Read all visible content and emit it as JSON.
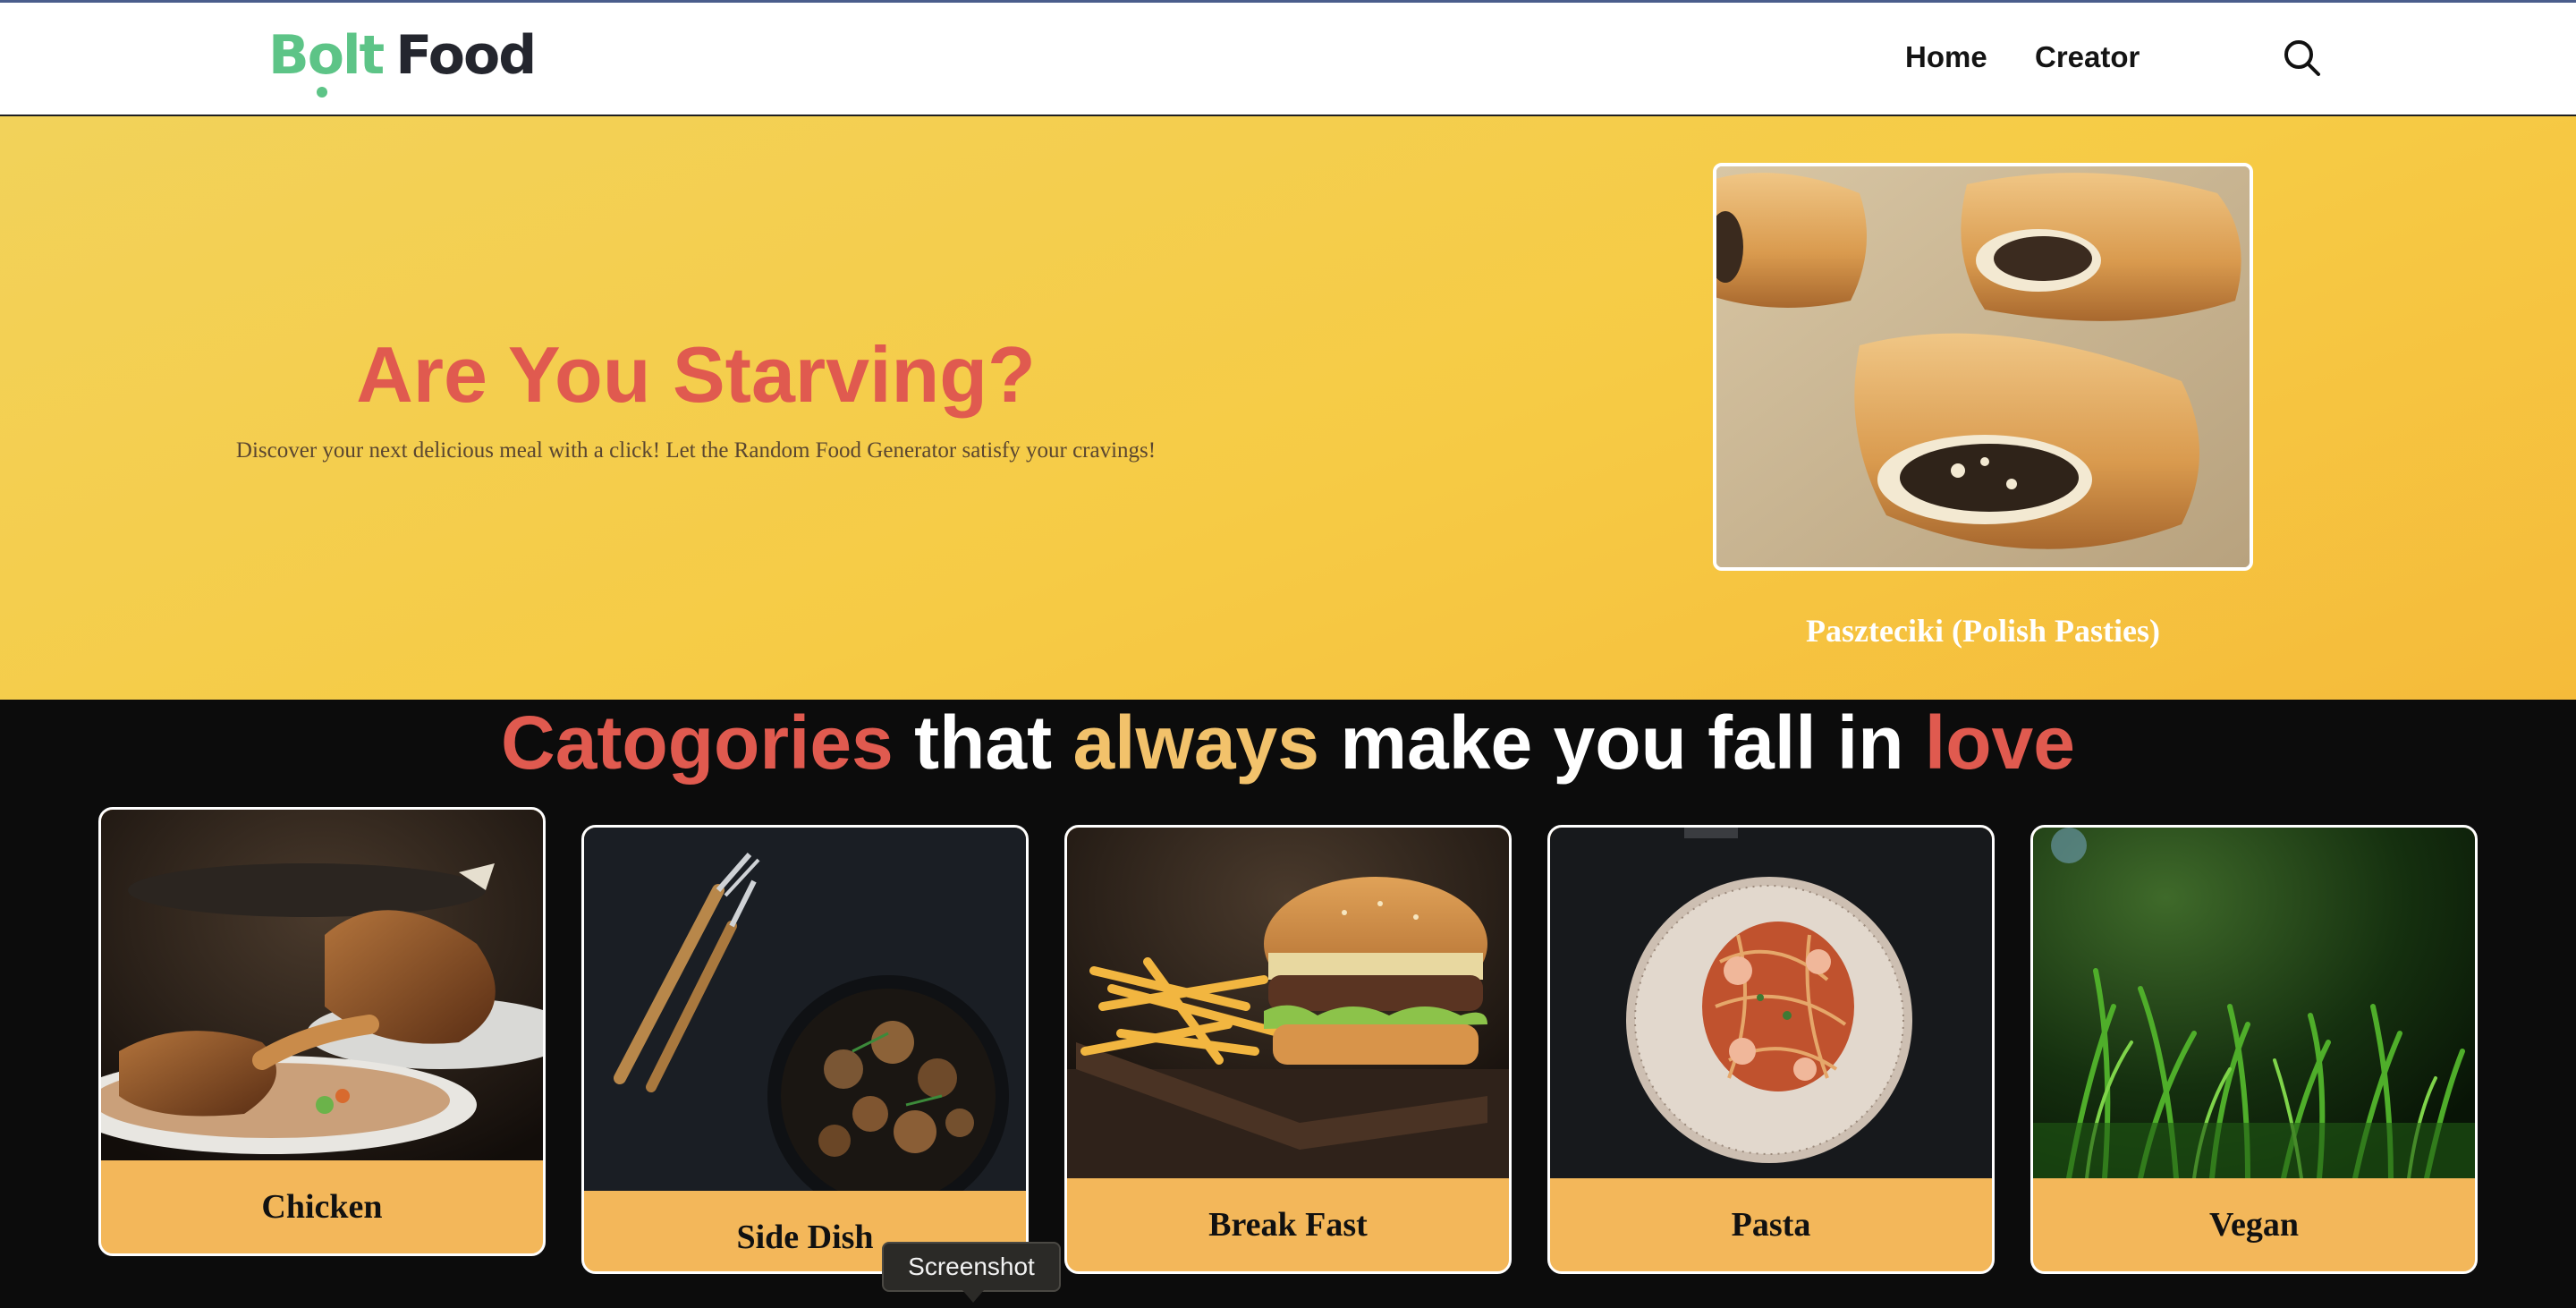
{
  "header": {
    "logo": {
      "part1": "Bolt",
      "part2": "Food"
    },
    "nav": [
      {
        "label": "Home"
      },
      {
        "label": "Creator"
      }
    ],
    "search_icon": "search-icon"
  },
  "hero": {
    "title": "Are You Starving?",
    "subtitle": "Discover your next delicious meal with a click! Let the Random Food Generator satisfy your cravings!",
    "featured": {
      "caption": "Paszteciki (Polish Pasties)"
    }
  },
  "categories": {
    "heading": [
      {
        "text": "Catogories",
        "color": "#e05a4f"
      },
      {
        "text": " that ",
        "color": "#ffffff"
      },
      {
        "text": "always",
        "color": "#f2c26b"
      },
      {
        "text": " make you fall in ",
        "color": "#ffffff"
      },
      {
        "text": "love",
        "color": "#e05a4f"
      }
    ],
    "items": [
      {
        "label": "Chicken"
      },
      {
        "label": "Side Dish"
      },
      {
        "label": "Break Fast"
      },
      {
        "label": "Pasta"
      },
      {
        "label": "Vegan"
      }
    ]
  },
  "tooltip": {
    "text": "Screenshot"
  },
  "colors": {
    "brand_green": "#5dc487",
    "brand_dark": "#24262e",
    "accent_red": "#e05a4f",
    "accent_gold": "#f2c26b",
    "card_bg": "#f3b75a",
    "page_bg": "#0c0c0c",
    "hero_bg": "#f6cb45"
  }
}
